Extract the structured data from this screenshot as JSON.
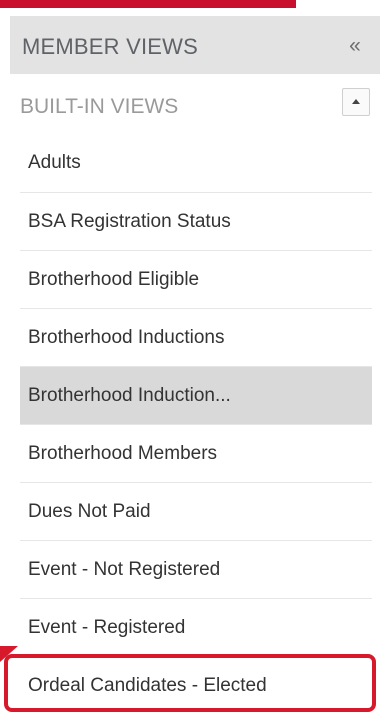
{
  "panel": {
    "title": "MEMBER VIEWS",
    "collapse_icon": "chevron-double-left-icon",
    "collapse_glyph": "«"
  },
  "section": {
    "title": "BUILT-IN VIEWS",
    "toggle_icon": "caret-up-icon"
  },
  "views": [
    {
      "label": "Adults"
    },
    {
      "label": "BSA Registration Status"
    },
    {
      "label": "Brotherhood Eligible"
    },
    {
      "label": "Brotherhood Inductions"
    },
    {
      "label": "Brotherhood Induction...",
      "selected": true
    },
    {
      "label": "Brotherhood Members"
    },
    {
      "label": "Dues Not Paid"
    },
    {
      "label": "Event - Not Registered"
    },
    {
      "label": "Event - Registered"
    },
    {
      "label": "Ordeal Candidates - Elected",
      "highlighted": true
    }
  ],
  "colors": {
    "accent": "#c8102e",
    "highlight": "#d7192c",
    "header_bg": "#e3e3e3",
    "selected_bg": "#d9d9d9"
  }
}
